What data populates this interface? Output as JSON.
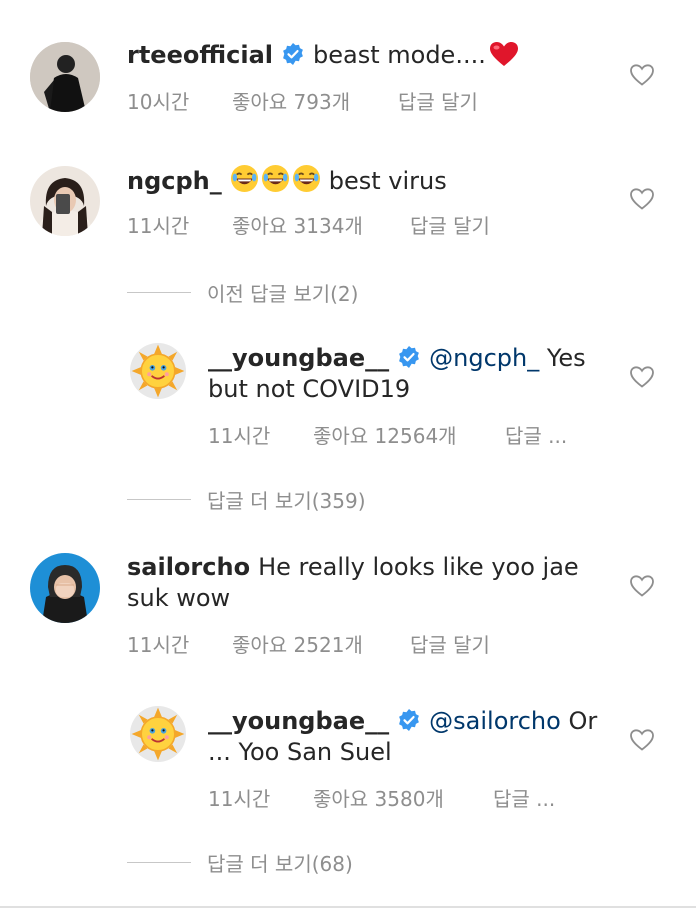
{
  "comments": [
    {
      "username": "rteeofficial",
      "verified": true,
      "text": "beast mode....",
      "emoji": "heart",
      "time": "10시간",
      "likes": "좋아요 793개",
      "reply": "답글 달기"
    },
    {
      "username": "ngcph_",
      "verified": false,
      "emoji": "😂😂😂",
      "text": "best virus",
      "time": "11시간",
      "likes": "좋아요 3134개",
      "reply": "답글 달기",
      "previous_replies": "이전 답글 보기(2)",
      "replies": [
        {
          "username": "__youngbae__",
          "verified": true,
          "mention": "@ngcph_",
          "text_line1": "Yes",
          "text_line2": "but not COVID19",
          "time": "11시간",
          "likes": "좋아요 12564개",
          "reply": "답글 ..."
        }
      ],
      "more_replies": "답글 더 보기(359)"
    },
    {
      "username": "sailorcho",
      "verified": false,
      "text_line1": "He really looks like yoo jae",
      "text_line2": "suk wow",
      "time": "11시간",
      "likes": "좋아요 2521개",
      "reply": "답글 달기",
      "replies": [
        {
          "username": "__youngbae__",
          "verified": true,
          "mention": "@sailorcho",
          "text_line1": "Or",
          "text_line2": "... Yoo San Suel",
          "time": "11시간",
          "likes": "좋아요 3580개",
          "reply": "답글 ..."
        }
      ],
      "more_replies": "답글 더 보기(68)"
    }
  ],
  "colors": {
    "text": "#262626",
    "secondary": "#8e8e8e",
    "mention": "#00376b",
    "verified": "#3897f0",
    "heart_emoji": "#e0162b"
  }
}
